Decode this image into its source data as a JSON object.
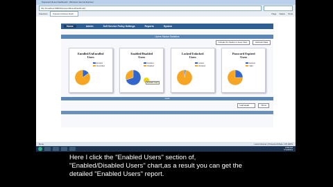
{
  "browser": {
    "title": "Password Reset Dashboard - Windows Internet Explorer",
    "address": "http://localhost:8080/PasswordReset/Dashboard",
    "tab_label": "Password Reset Dash...",
    "favorites_label": "Favorites",
    "tools": [
      "Page",
      "Safety",
      "Tools"
    ]
  },
  "app": {
    "logo": "PR",
    "logo_tagline": "password selfservice",
    "logout": "Logout"
  },
  "nav": {
    "items": [
      "Home",
      "Admin",
      "Self Service Policy Settings",
      "Reports",
      "System"
    ]
  },
  "dashboard": {
    "header": "Users Status Statistics",
    "buttons": [
      "Include OU Status in Area View",
      "Refresh Data"
    ],
    "charts": [
      {
        "title_l1": "Enrolled/UnEnrolled",
        "title_l2": "Users",
        "legend": [
          "Enrolled",
          "Unenrolled"
        ],
        "colors": [
          "#3366cc",
          "#f6a623"
        ],
        "values": [
          15,
          85
        ]
      },
      {
        "title_l1": "Enabled/Disabled",
        "title_l2": "Users",
        "legend": [
          "Enabled",
          "Disabled"
        ],
        "colors": [
          "#3366cc",
          "#f6a623"
        ],
        "values": [
          70,
          30
        ]
      },
      {
        "title_l1": "Locked/Unlocked",
        "title_l2": "Users",
        "legend": [
          "Locked",
          "Unlocked"
        ],
        "colors": [
          "#3366cc",
          "#f6a623"
        ],
        "values": [
          3,
          97
        ]
      },
      {
        "title_l1": "Password Expired",
        "title_l2": "Users",
        "legend": [
          "Expired",
          "Valid"
        ],
        "colors": [
          "#3366cc",
          "#f6a623"
        ],
        "values": [
          25,
          75
        ]
      }
    ],
    "tooltip": "Enabled Users",
    "lower_header": "Audit",
    "pager_select": "Last week",
    "pager_button": "Show"
  },
  "status": {
    "left": "Done",
    "zone": "Local intranet | Protected Mode: Off",
    "zoom": "100%"
  },
  "taskbar": {
    "time": "3:58 PM",
    "date": "7/14/2011"
  },
  "caption": {
    "line1": "Here I click the \"Enabled Users\" section of,",
    "line2": "\"Enabled/Disabled Users\" chart,as a result you can get the",
    "line3": "detailed \"Enabled Users\" report."
  }
}
